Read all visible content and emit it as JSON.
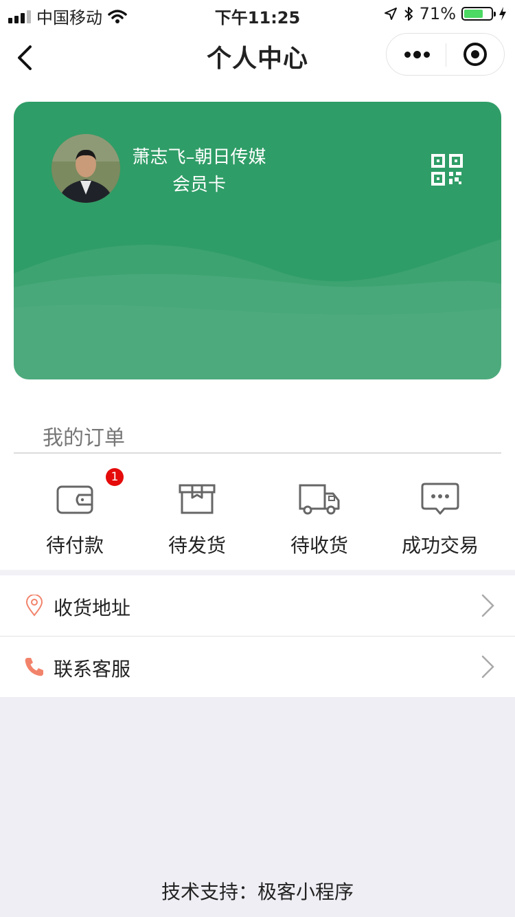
{
  "status_bar": {
    "carrier": "中国移动",
    "time": "下午11:25",
    "battery_level": "71%",
    "battery_fraction": 0.71,
    "battery_color": "#4cd964"
  },
  "nav": {
    "title": "个人中心",
    "back_icon": "chevron-left-icon",
    "more_icon": "more-dots-icon",
    "close_icon": "target-circle-icon"
  },
  "card": {
    "name": "萧志飞–朝日传媒",
    "type": "会员卡",
    "background": "#2f9d67",
    "qr_icon": "qr-code-icon"
  },
  "orders": {
    "title": "我的订单",
    "items": [
      {
        "label": "待付款",
        "icon": "wallet-icon",
        "badge": "1"
      },
      {
        "label": "待发货",
        "icon": "package-box-icon"
      },
      {
        "label": "待收货",
        "icon": "delivery-truck-icon"
      },
      {
        "label": "成功交易",
        "icon": "chat-bubble-icon"
      }
    ],
    "badge_color": "#e50b0b"
  },
  "menu": [
    {
      "label": "收货地址",
      "icon": "location-pin-icon",
      "icon_color": "#f2836b"
    },
    {
      "label": "联系客服",
      "icon": "phone-icon",
      "icon_color": "#f2836b"
    }
  ],
  "footer": "技术支持：极客小程序"
}
